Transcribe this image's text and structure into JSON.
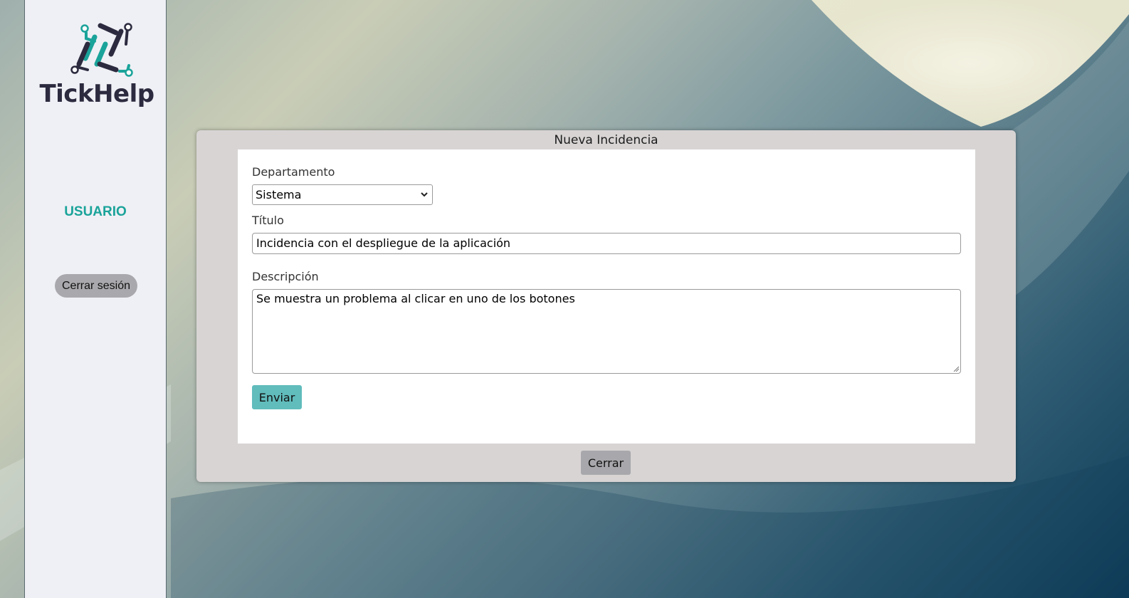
{
  "sidebar": {
    "brand": "TickHelp",
    "user_label": "USUARIO",
    "logout_label": "Cerrar sesión"
  },
  "modal": {
    "title": "Nueva Incidencia",
    "form": {
      "department_label": "Departamento",
      "department_value": "Sistema",
      "title_label": "Título",
      "title_value": "Incidencia con el despliegue de la aplicación",
      "description_label": "Descripción",
      "description_value": "Se muestra un problema al clicar en uno de los botones",
      "submit_label": "Enviar"
    },
    "close_label": "Cerrar"
  },
  "colors": {
    "brand_dark": "#2b2a3f",
    "brand_teal": "#1aa39a",
    "submit_button": "#61bcbc",
    "close_button": "#a8a8ac",
    "modal_background": "#d8d4d4",
    "sidebar_background": "#eff0f5"
  },
  "icons": {
    "logo": "circuit-logo-icon",
    "select_arrow": "chevron-down-icon",
    "textarea_resize": "resize-grip-icon"
  }
}
